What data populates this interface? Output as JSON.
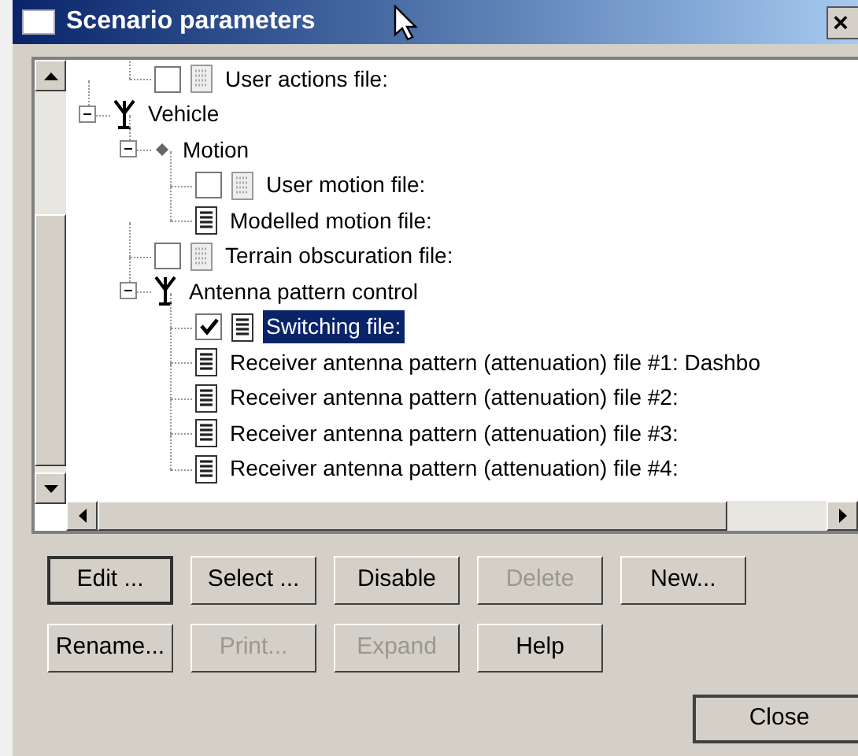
{
  "window": {
    "title": "Scenario parameters",
    "close": "×"
  },
  "tree": [
    {
      "kind": "group",
      "children": [
        {
          "kind": "checkbox",
          "label": "User actions file:",
          "checked": false,
          "selected": false
        }
      ]
    },
    {
      "kind": "antenna",
      "label": "Vehicle",
      "expanded": true,
      "selected": false,
      "children": [
        {
          "kind": "diamond",
          "label": "Motion",
          "expanded": true,
          "selected": false,
          "children": [
            {
              "kind": "checkbox",
              "label": "User motion file:",
              "checked": false,
              "selected": false
            },
            {
              "kind": "file",
              "label": "Modelled motion file:",
              "selected": false
            }
          ]
        },
        {
          "kind": "checkbox",
          "label": "Terrain obscuration file:",
          "checked": false,
          "selected": false
        },
        {
          "kind": "antenna",
          "label": "Antenna pattern control",
          "expanded": true,
          "selected": false,
          "children": [
            {
              "kind": "checkbox",
              "label": "Switching file:",
              "checked": true,
              "selected": true
            },
            {
              "kind": "file",
              "label": "Receiver antenna pattern (attenuation) file #1: Dashbo",
              "selected": false
            },
            {
              "kind": "file",
              "label": "Receiver antenna pattern (attenuation) file #2:",
              "selected": false
            },
            {
              "kind": "file",
              "label": "Receiver antenna pattern (attenuation) file #3:",
              "selected": false
            },
            {
              "kind": "file",
              "label": "Receiver antenna pattern (attenuation) file #4:",
              "selected": false
            }
          ]
        }
      ]
    }
  ],
  "button_rows": [
    [
      {
        "label": "Edit ...",
        "disabled": false,
        "default": true
      },
      {
        "label": "Select ...",
        "disabled": false,
        "default": false
      },
      {
        "label": "Disable",
        "disabled": false,
        "default": false
      },
      {
        "label": "Delete",
        "disabled": true,
        "default": false
      },
      {
        "label": "New...",
        "disabled": false,
        "default": false
      }
    ],
    [
      {
        "label": "Rename...",
        "disabled": false,
        "default": false
      },
      {
        "label": "Print...",
        "disabled": true,
        "default": false
      },
      {
        "label": "Expand",
        "disabled": true,
        "default": false
      },
      {
        "label": "Help",
        "disabled": false,
        "default": false
      }
    ]
  ],
  "close_button": {
    "label": "Close"
  }
}
